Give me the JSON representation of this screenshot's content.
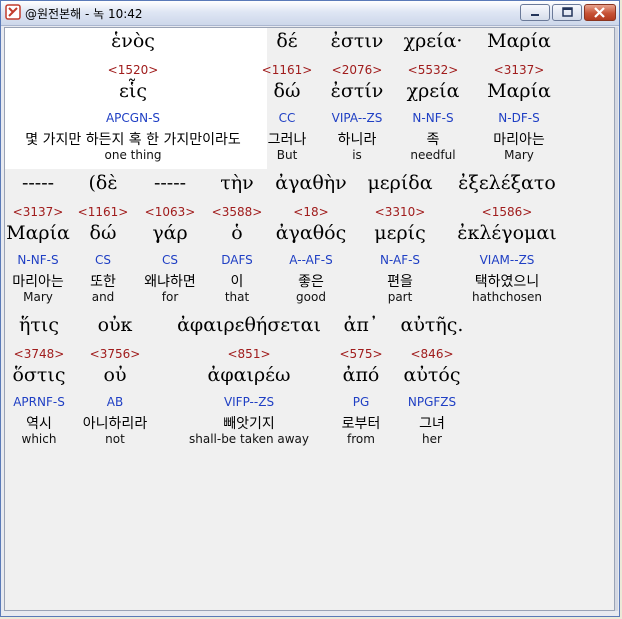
{
  "window": {
    "title": "@원전본해 - 녹 10:42",
    "icon": "app-logo-icon"
  },
  "rows": [
    [
      {
        "word": "ἑνὸς",
        "strong": "<1520>",
        "lemma": "εἷς",
        "parse": "APCGN-S",
        "korean": "몇 가지만 하든지 혹 한 가지만이라도",
        "english": "one thing"
      },
      {
        "word": "δέ",
        "strong": "<1161>",
        "lemma": "δώ",
        "parse": "CC",
        "korean": "그러나",
        "english": "But"
      },
      {
        "word": "ἐστιν",
        "strong": "<2076>",
        "lemma": "ἐστίν",
        "parse": "VIPA--ZS",
        "korean": "하니라",
        "english": "is"
      },
      {
        "word": "χρεία·",
        "strong": "<5532>",
        "lemma": "χρεία",
        "parse": "N-NF-S",
        "korean": "족",
        "english": "needful"
      },
      {
        "word": "Μαρία",
        "strong": "<3137>",
        "lemma": "Μαρία",
        "parse": "N-DF-S",
        "korean": "마리아는",
        "english": "Mary"
      }
    ],
    [
      {
        "word": "-----",
        "strong": "<3137>",
        "lemma": "Μαρία",
        "parse": "N-NF-S",
        "korean": "마리아는",
        "english": "Mary"
      },
      {
        "word": "(δὲ",
        "strong": "<1161>",
        "lemma": "δώ",
        "parse": "CS",
        "korean": "또한",
        "english": "and"
      },
      {
        "word": "-----",
        "strong": "<1063>",
        "lemma": "γάρ",
        "parse": "CS",
        "korean": "왜냐하면",
        "english": "for"
      },
      {
        "word": "τὴν",
        "strong": "<3588>",
        "lemma": "ὁ",
        "parse": "DAFS",
        "korean": "이",
        "english": "that"
      },
      {
        "word": "ἀγαθὴν",
        "strong": "<18>",
        "lemma": "ἀγαθός",
        "parse": "A--AF-S",
        "korean": "좋은",
        "english": "good"
      },
      {
        "word": "μερίδα",
        "strong": "<3310>",
        "lemma": "μερίς",
        "parse": "N-AF-S",
        "korean": "편을",
        "english": "part"
      },
      {
        "word": "ἐξελέξατο",
        "strong": "<1586>",
        "lemma": "ἐκλέγομαι",
        "parse": "VIAM--ZS",
        "korean": "택하였으니",
        "english": "hathchosen"
      }
    ],
    [
      {
        "word": "ἥτις",
        "strong": "<3748>",
        "lemma": "ὅστις",
        "parse": "APRNF-S",
        "korean": "역시",
        "english": "which"
      },
      {
        "word": "οὐκ",
        "strong": "<3756>",
        "lemma": "οὐ",
        "parse": "AB",
        "korean": "아니하리라",
        "english": "not"
      },
      {
        "word": "ἀφαιρεθήσεται",
        "strong": "<851>",
        "lemma": "ἀφαιρέω",
        "parse": "VIFP--ZS",
        "korean": "빼앗기지",
        "english": "shall-be taken away"
      },
      {
        "word": "ἀπ᾽",
        "strong": "<575>",
        "lemma": "ἀπό",
        "parse": "PG",
        "korean": "로부터",
        "english": "from"
      },
      {
        "word": "αὐτῆς.",
        "strong": "<846>",
        "lemma": "αὐτός",
        "parse": "NPGFZS",
        "korean": "그녀",
        "english": "her"
      }
    ]
  ]
}
